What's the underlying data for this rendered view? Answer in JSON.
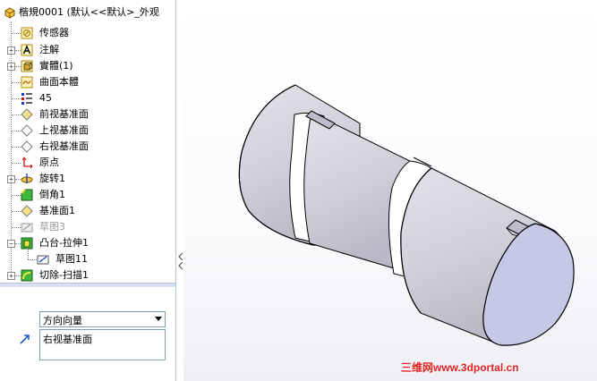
{
  "tree": {
    "root_label": "楷規0001  (默认<<默认>_外观",
    "items": [
      {
        "label": "传感器",
        "icon": "sensor-folder-icon"
      },
      {
        "label": "注解",
        "icon": "annotation-icon"
      },
      {
        "label": "實體(1)",
        "icon": "solid-bodies-icon"
      },
      {
        "label": "曲面本體",
        "icon": "surface-bodies-icon"
      },
      {
        "label": "45",
        "icon": "material-icon"
      },
      {
        "label": "前视基准面",
        "icon": "plane-icon"
      },
      {
        "label": "上视基准面",
        "icon": "plane-icon"
      },
      {
        "label": "右视基准面",
        "icon": "plane-icon"
      },
      {
        "label": "原点",
        "icon": "origin-icon"
      },
      {
        "label": "旋转1",
        "icon": "revolve-icon"
      },
      {
        "label": "倒角1",
        "icon": "chamfer-icon"
      },
      {
        "label": "基准面1",
        "icon": "plane-icon"
      },
      {
        "label": "草图3",
        "icon": "sketch-icon"
      },
      {
        "label": "凸台-拉伸1",
        "icon": "extrude-icon"
      },
      {
        "label": "草图11",
        "icon": "sketch-icon"
      },
      {
        "label": "切除-扫描1",
        "icon": "cut-sweep-icon"
      }
    ]
  },
  "property_manager": {
    "direction_select_value": "方向向量",
    "direction_list_item": "右视基准面"
  },
  "watermark": "三维网www.3dportal.cn",
  "colors": {
    "model_face": "#d2d2dc",
    "model_shadow": "#a9a9b6",
    "end_cap": "#c8c8e6",
    "edge": "#000000",
    "watermark": "#e02020"
  }
}
